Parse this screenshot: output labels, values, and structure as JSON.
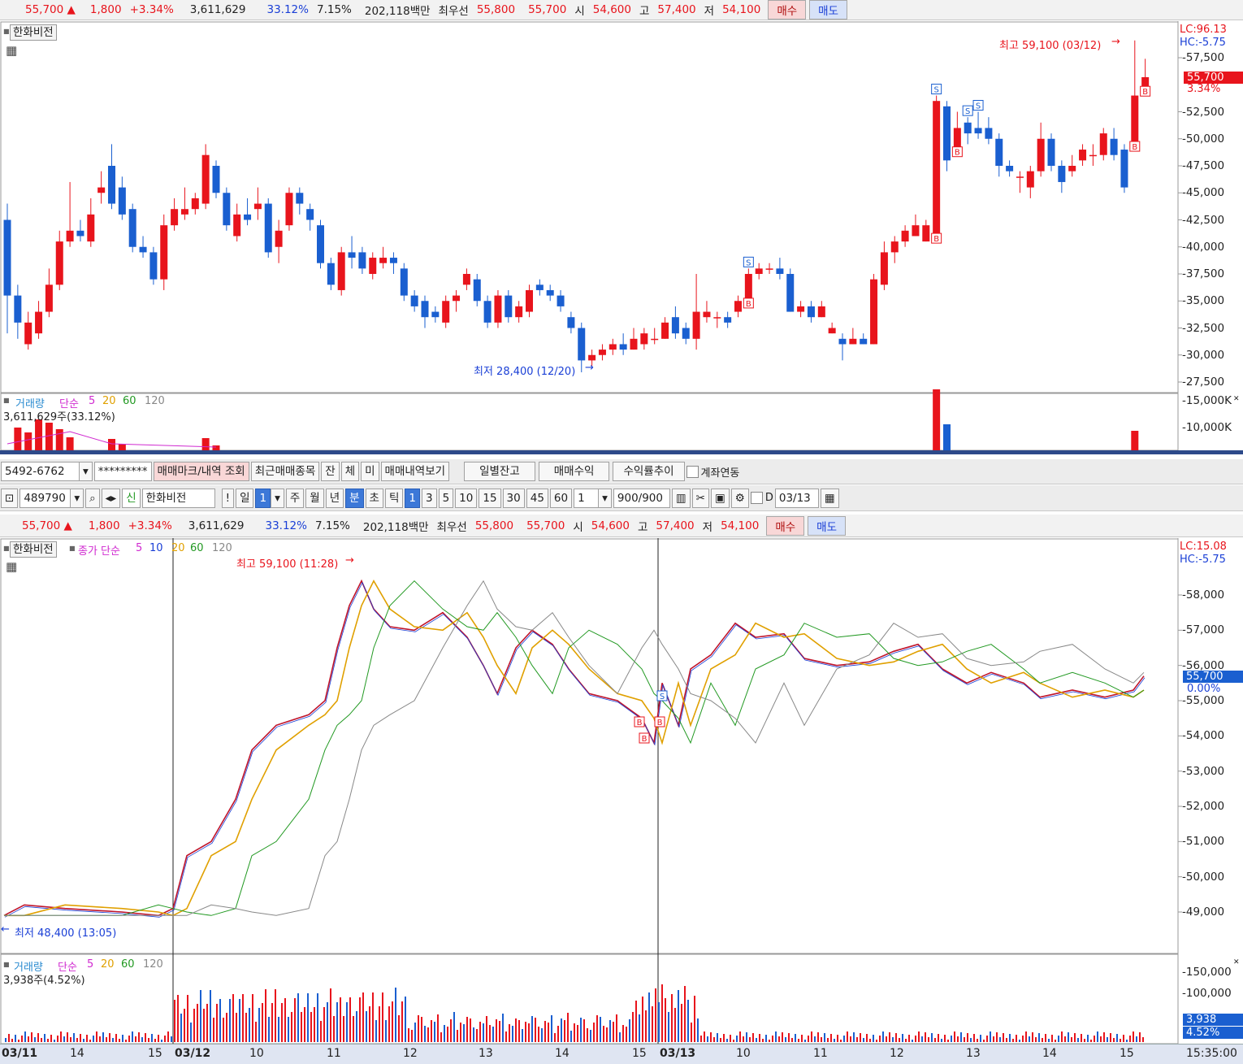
{
  "quote": {
    "price": "55,700 ▲",
    "change": "1,800",
    "change_pct": "+3.34%",
    "volume": "3,611,629",
    "vol_ratio": "33.12%",
    "turnover": "7.15%",
    "amount": "202,118백만",
    "best_label": "최우선",
    "ask": "55,800",
    "bid": "55,700",
    "open_label": "시",
    "open": "54,600",
    "high_label": "고",
    "high": "57,400",
    "low_label": "저",
    "low": "54,100",
    "buy": "매수",
    "sell": "매도"
  },
  "daily": {
    "stock_name": "한화비전",
    "lc": "LC:96.13",
    "hc": "HC:-5.75",
    "high_note": "최고 59,100 (03/12)",
    "low_note": "최저 28,400 (12/20)",
    "price_tag": "55,700",
    "pct_tag": "3.34%",
    "y_labels": [
      "57,500",
      "52,500",
      "50,000",
      "47,500",
      "45,000",
      "42,500",
      "40,000",
      "37,500",
      "35,000",
      "32,500",
      "30,000",
      "27,500"
    ],
    "volume": {
      "title": "거래량",
      "ma_label": "단순",
      "ma5": "5",
      "ma20": "20",
      "ma60": "60",
      "ma120": "120",
      "value": "3,611,629주(33.12%)",
      "y_labels": [
        "15,000K",
        "10,000K"
      ]
    }
  },
  "toolbar1": {
    "account": "5492-6762",
    "password": "*********",
    "b1": "매매마크/내역 조회",
    "b2": "최근매매종목",
    "b3": "잔",
    "b4": "체",
    "b5": "미",
    "b6": "매매내역보기",
    "b7": "일별잔고",
    "b8": "매매수익",
    "b9": "수익률추이",
    "link": "계좌연동"
  },
  "toolbar2": {
    "code": "489790",
    "credit": "신",
    "name": "한화비전",
    "excl": "!",
    "periods": [
      "일",
      "1",
      "주",
      "월",
      "년",
      "분",
      "초",
      "틱",
      "1",
      "3",
      "5",
      "10",
      "15",
      "30",
      "45",
      "60"
    ],
    "mult": "1",
    "count": "900/900",
    "d_label": "D",
    "date": "03/13"
  },
  "intraday": {
    "stock_name": "한화비전",
    "ma_title": "종가 단순",
    "ma5": "5",
    "ma10": "10",
    "ma20": "20",
    "ma60": "60",
    "ma120": "120",
    "lc": "LC:15.08",
    "hc": "HC:-5.75",
    "high_note": "최고 59,100 (11:28)",
    "low_note": "최저 48,400 (13:05)",
    "price_tag": "55,700",
    "pct_tag": "0.00%",
    "y_labels": [
      "58,000",
      "57,000",
      "56,000",
      "55,000",
      "54,000",
      "53,000",
      "52,000",
      "51,000",
      "50,000",
      "49,000"
    ],
    "volume": {
      "title": "거래량",
      "ma_label": "단순",
      "ma5": "5",
      "ma20": "20",
      "ma60": "60",
      "ma120": "120",
      "value": "3,938주(4.52%)",
      "y_labels": [
        "150,000",
        "100,000"
      ],
      "tag": "3,938",
      "tag_pct": "4.52%"
    }
  },
  "xaxis": {
    "labels": [
      "03/11",
      "14",
      "15",
      "03/12",
      "10",
      "11",
      "12",
      "13",
      "14",
      "15",
      "03/13",
      "10",
      "11",
      "12",
      "13",
      "14",
      "15"
    ],
    "time": "15:35:00"
  },
  "colors": {
    "up": "#e8141c",
    "down": "#1a5fd0",
    "accent": "#2d4a8a"
  },
  "chart_data": [
    {
      "type": "candlestick",
      "title": "한화비전",
      "ylim": [
        27500,
        59100
      ],
      "candles": [
        {
          "o": 42500,
          "c": 35500,
          "h": 44000,
          "l": 32000
        },
        {
          "o": 35500,
          "c": 33000,
          "h": 36500,
          "l": 31500
        },
        {
          "o": 31000,
          "c": 33000,
          "h": 34000,
          "l": 30500
        },
        {
          "o": 32000,
          "c": 34000,
          "h": 35000,
          "l": 31500
        },
        {
          "o": 34000,
          "c": 36500,
          "h": 38000,
          "l": 33500
        },
        {
          "o": 36500,
          "c": 40500,
          "h": 41500,
          "l": 36000
        },
        {
          "o": 40500,
          "c": 41500,
          "h": 46000,
          "l": 40000
        },
        {
          "o": 41500,
          "c": 41000,
          "h": 42500,
          "l": 40500
        },
        {
          "o": 40500,
          "c": 43000,
          "h": 44500,
          "l": 40000
        },
        {
          "o": 45000,
          "c": 45500,
          "h": 47000,
          "l": 44000
        },
        {
          "o": 47500,
          "c": 44000,
          "h": 49500,
          "l": 43500
        },
        {
          "o": 45500,
          "c": 43000,
          "h": 46500,
          "l": 42500
        },
        {
          "o": 43500,
          "c": 40000,
          "h": 44000,
          "l": 39500
        },
        {
          "o": 40000,
          "c": 39500,
          "h": 41000,
          "l": 39000
        },
        {
          "o": 39500,
          "c": 37000,
          "h": 40000,
          "l": 36500
        },
        {
          "o": 37000,
          "c": 42000,
          "h": 43000,
          "l": 36000
        },
        {
          "o": 42000,
          "c": 43500,
          "h": 44500,
          "l": 41500
        },
        {
          "o": 43000,
          "c": 43500,
          "h": 45500,
          "l": 42500
        },
        {
          "o": 43500,
          "c": 44500,
          "h": 45000,
          "l": 43000
        },
        {
          "o": 44000,
          "c": 48500,
          "h": 49500,
          "l": 43500
        },
        {
          "o": 47500,
          "c": 45000,
          "h": 48000,
          "l": 44500
        },
        {
          "o": 45000,
          "c": 42000,
          "h": 45500,
          "l": 41500
        },
        {
          "o": 41000,
          "c": 43000,
          "h": 44000,
          "l": 40500
        },
        {
          "o": 43000,
          "c": 42500,
          "h": 44500,
          "l": 42000
        },
        {
          "o": 43500,
          "c": 44000,
          "h": 45500,
          "l": 42500
        },
        {
          "o": 44000,
          "c": 39500,
          "h": 44500,
          "l": 39000
        },
        {
          "o": 40000,
          "c": 41500,
          "h": 42500,
          "l": 38500
        },
        {
          "o": 42000,
          "c": 45000,
          "h": 45500,
          "l": 41500
        },
        {
          "o": 45000,
          "c": 44000,
          "h": 45500,
          "l": 43000
        },
        {
          "o": 43500,
          "c": 42500,
          "h": 44000,
          "l": 41500
        },
        {
          "o": 42000,
          "c": 38500,
          "h": 42500,
          "l": 38000
        },
        {
          "o": 38500,
          "c": 36500,
          "h": 39000,
          "l": 36000
        },
        {
          "o": 36000,
          "c": 39500,
          "h": 40000,
          "l": 35500
        },
        {
          "o": 39500,
          "c": 39000,
          "h": 41000,
          "l": 38000
        },
        {
          "o": 39500,
          "c": 38000,
          "h": 40000,
          "l": 37500
        },
        {
          "o": 37500,
          "c": 39000,
          "h": 39500,
          "l": 37000
        },
        {
          "o": 38500,
          "c": 39000,
          "h": 40000,
          "l": 38000
        },
        {
          "o": 39000,
          "c": 38500,
          "h": 39500,
          "l": 37500
        },
        {
          "o": 38000,
          "c": 35500,
          "h": 38500,
          "l": 35000
        },
        {
          "o": 35500,
          "c": 34500,
          "h": 36000,
          "l": 34000
        },
        {
          "o": 35000,
          "c": 33500,
          "h": 35500,
          "l": 32500
        },
        {
          "o": 34000,
          "c": 33500,
          "h": 34500,
          "l": 33000
        },
        {
          "o": 33000,
          "c": 35000,
          "h": 35500,
          "l": 32500
        },
        {
          "o": 35000,
          "c": 35500,
          "h": 36000,
          "l": 34000
        },
        {
          "o": 36500,
          "c": 37500,
          "h": 38000,
          "l": 36000
        },
        {
          "o": 37000,
          "c": 35000,
          "h": 37500,
          "l": 34500
        },
        {
          "o": 35000,
          "c": 33000,
          "h": 35500,
          "l": 32500
        },
        {
          "o": 33000,
          "c": 35500,
          "h": 36000,
          "l": 32500
        },
        {
          "o": 35500,
          "c": 33500,
          "h": 36000,
          "l": 33000
        },
        {
          "o": 33500,
          "c": 34500,
          "h": 35000,
          "l": 33000
        },
        {
          "o": 34000,
          "c": 36000,
          "h": 36500,
          "l": 33500
        },
        {
          "o": 36500,
          "c": 36000,
          "h": 37000,
          "l": 35500
        },
        {
          "o": 36000,
          "c": 35500,
          "h": 36500,
          "l": 35000
        },
        {
          "o": 35500,
          "c": 34500,
          "h": 36000,
          "l": 34000
        },
        {
          "o": 33500,
          "c": 32500,
          "h": 34000,
          "l": 32000
        },
        {
          "o": 32500,
          "c": 29500,
          "h": 33000,
          "l": 28400
        },
        {
          "o": 29500,
          "c": 30000,
          "h": 30500,
          "l": 29000
        },
        {
          "o": 30000,
          "c": 30500,
          "h": 31000,
          "l": 29500
        },
        {
          "o": 30500,
          "c": 31000,
          "h": 31500,
          "l": 30000
        },
        {
          "o": 31000,
          "c": 30500,
          "h": 32000,
          "l": 30000
        },
        {
          "o": 30500,
          "c": 31500,
          "h": 32500,
          "l": 30500
        },
        {
          "o": 31000,
          "c": 32000,
          "h": 32500,
          "l": 30500
        },
        {
          "o": 31500,
          "c": 31500,
          "h": 32500,
          "l": 31000
        },
        {
          "o": 31500,
          "c": 33000,
          "h": 33500,
          "l": 31500
        },
        {
          "o": 33500,
          "c": 32000,
          "h": 34500,
          "l": 31500
        },
        {
          "o": 32500,
          "c": 31500,
          "h": 33000,
          "l": 31000
        },
        {
          "o": 31500,
          "c": 34000,
          "h": 37500,
          "l": 30500
        },
        {
          "o": 33500,
          "c": 34000,
          "h": 35000,
          "l": 33000
        },
        {
          "o": 33500,
          "c": 33500,
          "h": 34000,
          "l": 32500
        },
        {
          "o": 33500,
          "c": 33000,
          "h": 34000,
          "l": 32500
        },
        {
          "o": 34000,
          "c": 35000,
          "h": 35500,
          "l": 33500
        },
        {
          "o": 35000,
          "c": 37500,
          "h": 38000,
          "l": 34500
        },
        {
          "o": 37500,
          "c": 38000,
          "h": 38500,
          "l": 37000
        },
        {
          "o": 38000,
          "c": 38000,
          "h": 38500,
          "l": 37500
        },
        {
          "o": 38000,
          "c": 37500,
          "h": 39000,
          "l": 37000
        },
        {
          "o": 37500,
          "c": 34000,
          "h": 38000,
          "l": 34000
        },
        {
          "o": 34000,
          "c": 34500,
          "h": 35000,
          "l": 33500
        },
        {
          "o": 34500,
          "c": 33500,
          "h": 35000,
          "l": 33000
        },
        {
          "o": 33500,
          "c": 34500,
          "h": 35000,
          "l": 33500
        },
        {
          "o": 32000,
          "c": 32500,
          "h": 33000,
          "l": 32000
        },
        {
          "o": 31500,
          "c": 31000,
          "h": 32000,
          "l": 29500
        },
        {
          "o": 31000,
          "c": 31500,
          "h": 32500,
          "l": 31000
        },
        {
          "o": 31500,
          "c": 31000,
          "h": 32000,
          "l": 31000
        },
        {
          "o": 31000,
          "c": 37000,
          "h": 37500,
          "l": 31000
        },
        {
          "o": 36500,
          "c": 39500,
          "h": 40500,
          "l": 36000
        },
        {
          "o": 39500,
          "c": 40500,
          "h": 41000,
          "l": 38500
        },
        {
          "o": 40500,
          "c": 41500,
          "h": 42000,
          "l": 40000
        },
        {
          "o": 41000,
          "c": 42000,
          "h": 43000,
          "l": 41000
        },
        {
          "o": 40500,
          "c": 42000,
          "h": 42500,
          "l": 40500
        },
        {
          "o": 41000,
          "c": 53500,
          "h": 54000,
          "l": 40500
        },
        {
          "o": 53000,
          "c": 48000,
          "h": 53500,
          "l": 47000
        },
        {
          "o": 49000,
          "c": 51000,
          "h": 52500,
          "l": 48500
        },
        {
          "o": 51500,
          "c": 50500,
          "h": 52000,
          "l": 49500
        },
        {
          "o": 51000,
          "c": 50500,
          "h": 52500,
          "l": 50000
        },
        {
          "o": 51000,
          "c": 50000,
          "h": 52000,
          "l": 49500
        },
        {
          "o": 50000,
          "c": 47500,
          "h": 50500,
          "l": 46500
        },
        {
          "o": 47500,
          "c": 47000,
          "h": 48000,
          "l": 46500
        },
        {
          "o": 46500,
          "c": 46500,
          "h": 47000,
          "l": 45000
        },
        {
          "o": 45500,
          "c": 47000,
          "h": 47500,
          "l": 44500
        },
        {
          "o": 47000,
          "c": 50000,
          "h": 51500,
          "l": 46500
        },
        {
          "o": 50000,
          "c": 47500,
          "h": 50500,
          "l": 47000
        },
        {
          "o": 47500,
          "c": 46000,
          "h": 48000,
          "l": 45000
        },
        {
          "o": 47000,
          "c": 47500,
          "h": 48500,
          "l": 46500
        },
        {
          "o": 48000,
          "c": 49000,
          "h": 49500,
          "l": 47500
        },
        {
          "o": 48500,
          "c": 48500,
          "h": 49500,
          "l": 47500
        },
        {
          "o": 48500,
          "c": 50500,
          "h": 51000,
          "l": 48000
        },
        {
          "o": 50000,
          "c": 48500,
          "h": 51000,
          "l": 48000
        },
        {
          "o": 49000,
          "c": 45500,
          "h": 49500,
          "l": 45000
        },
        {
          "o": 49500,
          "c": 54000,
          "h": 59100,
          "l": 49000
        },
        {
          "o": 54000,
          "c": 55700,
          "h": 57400,
          "l": 54100
        }
      ]
    }
  ]
}
